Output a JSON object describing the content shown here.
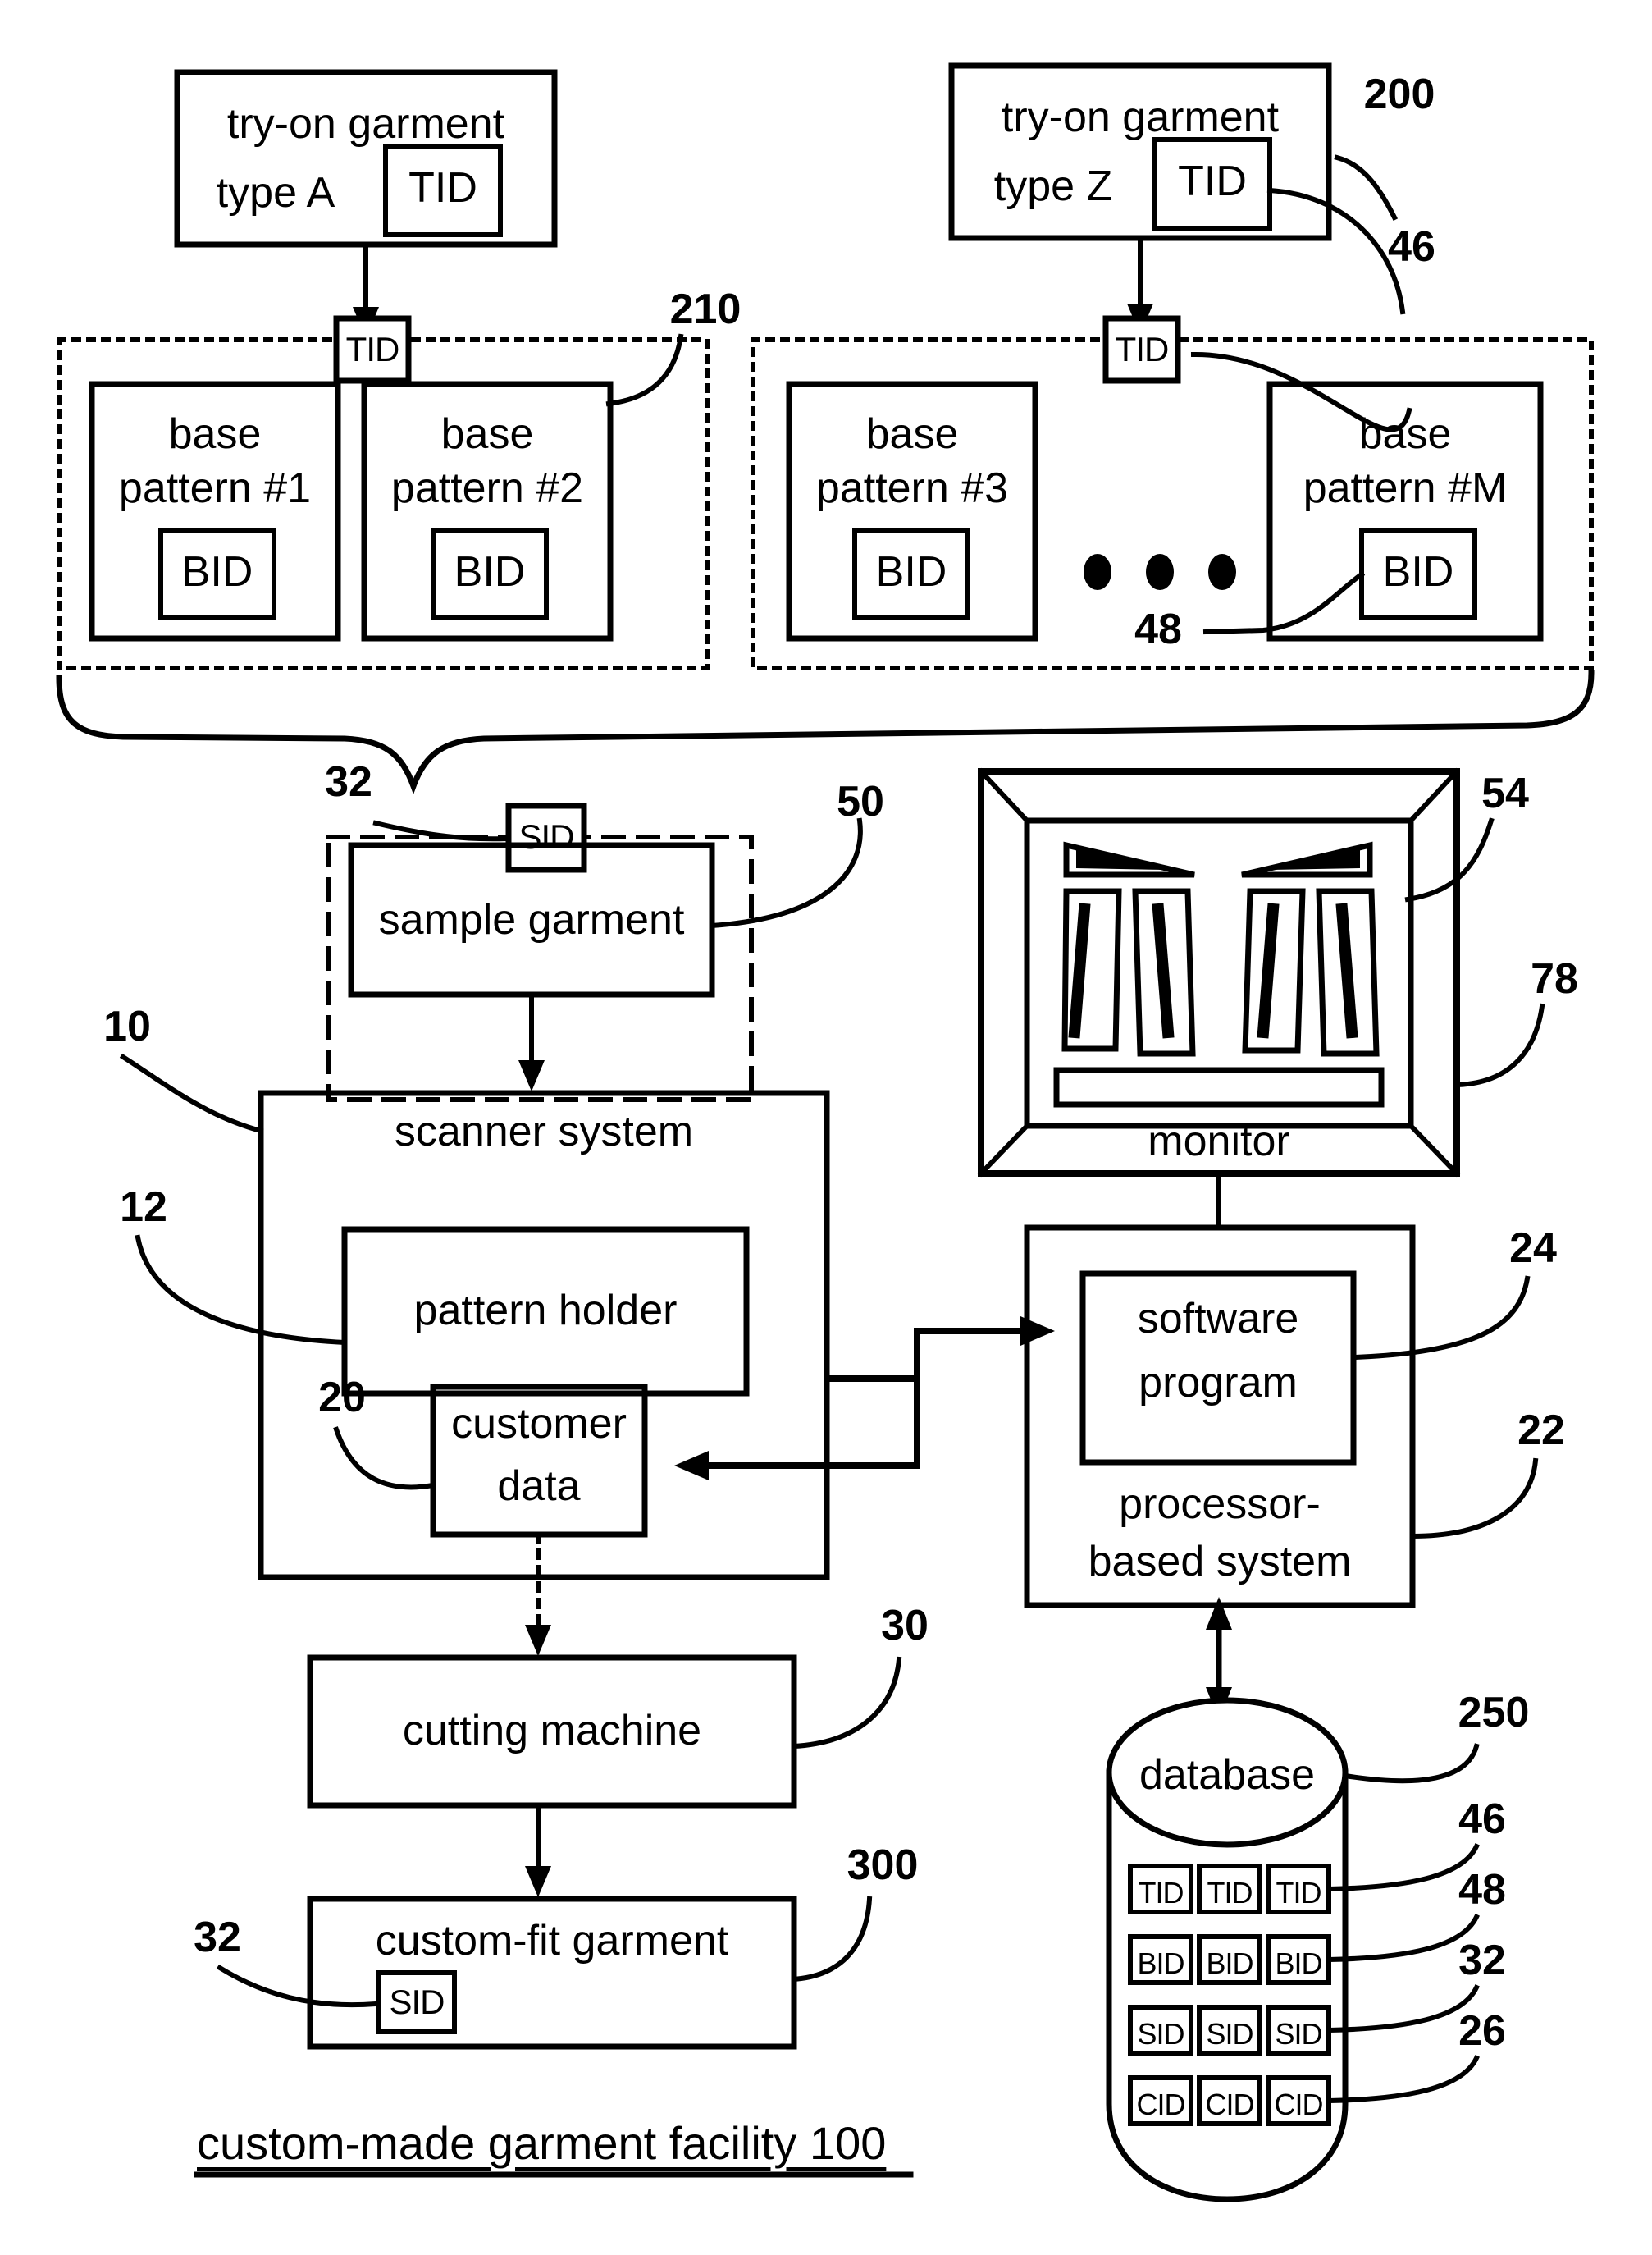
{
  "figure": {
    "caption": "custom-made garment facility 100",
    "type": "patent-block-diagram"
  },
  "nodes": {
    "tryon_a": {
      "line1": "try-on garment",
      "line2": "type A",
      "tag": "TID"
    },
    "tryon_z": {
      "line1": "try-on garment",
      "line2": "type Z",
      "tag": "TID"
    },
    "tid_left": {
      "label": "TID"
    },
    "tid_right": {
      "label": "TID"
    },
    "base1": {
      "line1": "base",
      "line2": "pattern #1",
      "tag": "BID"
    },
    "base2": {
      "line1": "base",
      "line2": "pattern #2",
      "tag": "BID"
    },
    "base3": {
      "line1": "base",
      "line2": "pattern #3",
      "tag": "BID"
    },
    "baseM": {
      "line1": "base",
      "line2": "pattern #M",
      "tag": "BID"
    },
    "sid_sample": {
      "label": "SID"
    },
    "sample_garment": {
      "label": "sample garment"
    },
    "scanner": {
      "label": "scanner system"
    },
    "pattern_holder": {
      "label": "pattern holder"
    },
    "customer_data": {
      "line1": "customer",
      "line2": "data"
    },
    "cutting_machine": {
      "label": "cutting machine"
    },
    "custom_fit": {
      "label": "custom-fit garment",
      "tag": "SID"
    },
    "monitor": {
      "label": "monitor"
    },
    "processor": {
      "line1": "processor-",
      "line2": "based system"
    },
    "software": {
      "line1": "software",
      "line2": "program"
    },
    "database": {
      "label": "database"
    }
  },
  "database_tags": {
    "row1": [
      "TID",
      "TID",
      "TID"
    ],
    "row2": [
      "BID",
      "BID",
      "BID"
    ],
    "row3": [
      "SID",
      "SID",
      "SID"
    ],
    "row4": [
      "CID",
      "CID",
      "CID"
    ]
  },
  "reference_numerals": {
    "n200": "200",
    "n46_top": "46",
    "n210": "210",
    "n48": "48",
    "n32_sample": "32",
    "n50": "50",
    "n54": "54",
    "n78": "78",
    "n10": "10",
    "n12": "12",
    "n20": "20",
    "n24": "24",
    "n22": "22",
    "n30": "30",
    "n300": "300",
    "n32_garment": "32",
    "n250": "250",
    "n46_db": "46",
    "n48_db": "48",
    "n32_db": "32",
    "n26_db": "26"
  },
  "ellipsis": {
    "dots": 3
  },
  "colors": {
    "ink": "#000000",
    "paper": "#ffffff"
  }
}
